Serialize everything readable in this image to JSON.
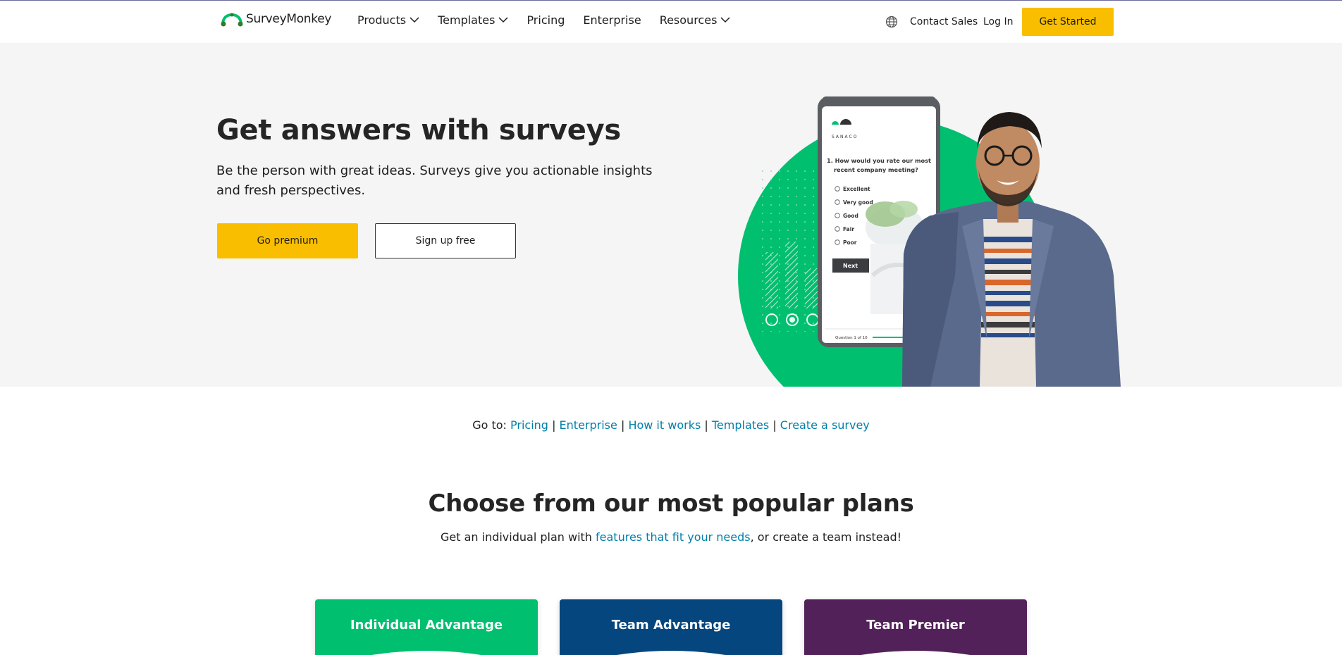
{
  "header": {
    "logo_text": "SurveyMonkey",
    "nav": [
      {
        "label": "Products",
        "has_dropdown": true
      },
      {
        "label": "Templates",
        "has_dropdown": true
      },
      {
        "label": "Pricing",
        "has_dropdown": false
      },
      {
        "label": "Enterprise",
        "has_dropdown": false
      },
      {
        "label": "Resources",
        "has_dropdown": true
      }
    ],
    "contact_sales": "Contact Sales",
    "log_in": "Log In",
    "get_started": "Get Started"
  },
  "hero": {
    "title": "Get answers with surveys",
    "subtitle": "Be the person with great ideas. Surveys give you actionable insights and fresh perspectives.",
    "primary_button": "Go premium",
    "secondary_button": "Sign up free",
    "phone": {
      "brand": "SANACO",
      "question": "1. How would you rate our most recent company meeting?",
      "options": [
        "Excellent",
        "Very good",
        "Good",
        "Fair",
        "Poor"
      ],
      "next_button": "Next",
      "progress_text": "Question 1 of 10"
    }
  },
  "goto": {
    "prefix": "Go to:",
    "links": [
      "Pricing",
      "Enterprise",
      "How it works",
      "Templates",
      "Create a survey"
    ]
  },
  "plans": {
    "title": "Choose from our most popular plans",
    "subtitle_before": "Get an individual plan with ",
    "subtitle_link": "features that fit your needs",
    "subtitle_after": ", or create a team instead!",
    "cards": [
      {
        "name": "Individual Advantage"
      },
      {
        "name": "Team Advantage"
      },
      {
        "name": "Team Premier"
      }
    ]
  },
  "colors": {
    "accent_yellow": "#f9be00",
    "brand_green": "#00bf6f",
    "link_blue": "#007faa",
    "team_blue": "#05467e",
    "premier_purple": "#532159",
    "hero_bg": "#f5f5f5"
  }
}
